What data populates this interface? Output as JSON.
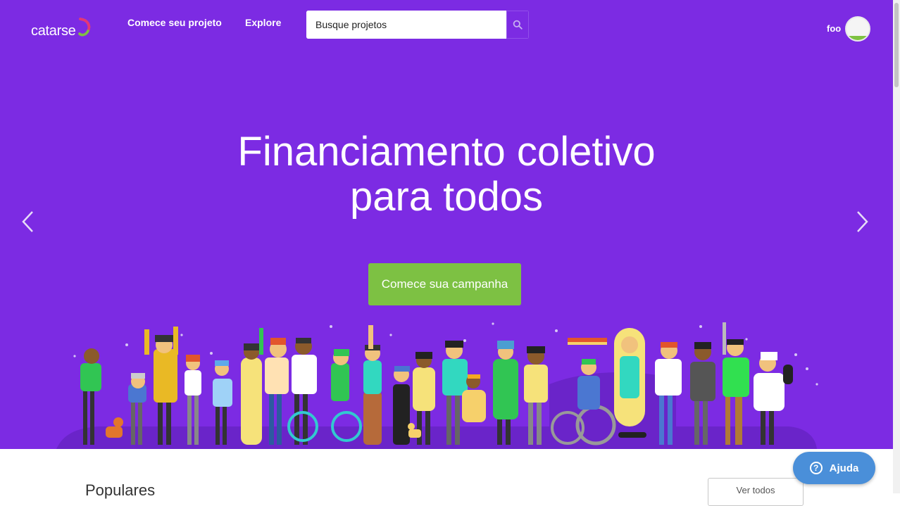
{
  "header": {
    "logo_text": "catarse",
    "nav": [
      "Comece seu projeto",
      "Explore"
    ],
    "search_placeholder": "Busque projetos",
    "user_name": "foo"
  },
  "hero": {
    "title_line1": "Financiamento coletivo",
    "title_line2": "para todos",
    "cta_label": "Comece sua campanha",
    "colors": {
      "background": "#7c2be3",
      "cta": "#7dc143"
    }
  },
  "section": {
    "title": "Populares",
    "see_all_label": "Ver todos"
  },
  "help": {
    "label": "Ajuda",
    "icon": "?"
  }
}
